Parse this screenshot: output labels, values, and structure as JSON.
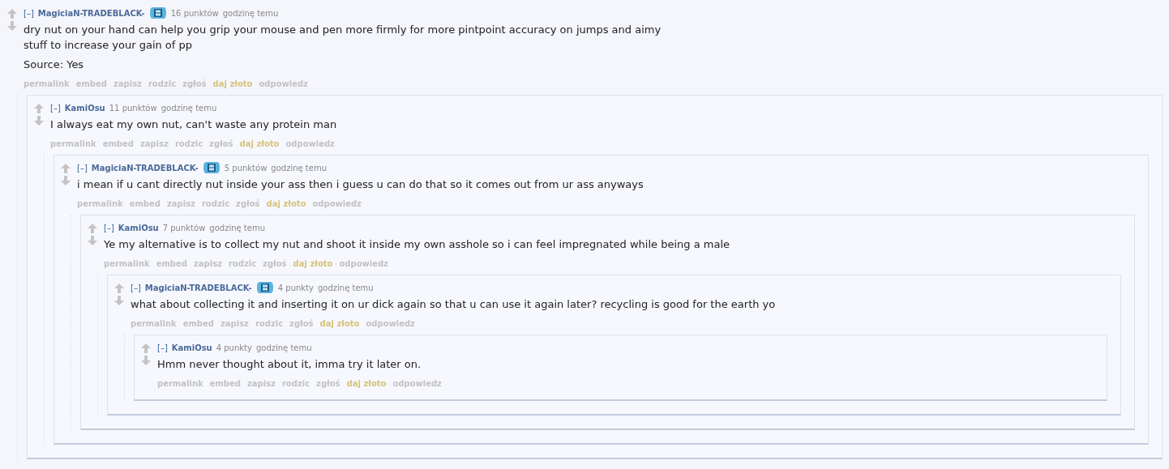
{
  "comments": [
    {
      "collapse": "[–]",
      "author": "MagiciaN-TRADEBLACK-",
      "flair": true,
      "score": "16 punktów",
      "time": "godzinę temu",
      "body": [
        "dry nut on your hand can help you grip your mouse and pen more firmly for more pintpoint accuracy on jumps and aimy stuff to increase your gain of pp",
        "Source: Yes"
      ],
      "buttons": [
        {
          "label": "permalink",
          "kind": "normal"
        },
        {
          "label": "embed",
          "kind": "normal"
        },
        {
          "label": "zapisz",
          "kind": "normal"
        },
        {
          "label": "rodzic",
          "kind": "normal"
        },
        {
          "label": "zgłoś",
          "kind": "normal"
        },
        {
          "label": "daj złoto",
          "kind": "gold"
        },
        {
          "label": "odpowiedz",
          "kind": "normal"
        }
      ],
      "children": [
        {
          "collapse": "[–]",
          "author": "KamiOsu",
          "flair": false,
          "score": "11 punktów",
          "time": "godzinę temu",
          "body": [
            "I always eat my own nut, can't waste any protein man"
          ],
          "buttons": [
            {
              "label": "permalink",
              "kind": "normal"
            },
            {
              "label": "embed",
              "kind": "normal"
            },
            {
              "label": "zapisz",
              "kind": "normal"
            },
            {
              "label": "rodzic",
              "kind": "normal"
            },
            {
              "label": "zgłoś",
              "kind": "normal"
            },
            {
              "label": "daj złoto",
              "kind": "gold"
            },
            {
              "label": "odpowiedz",
              "kind": "normal"
            }
          ],
          "children": [
            {
              "collapse": "[–]",
              "author": "MagiciaN-TRADEBLACK-",
              "flair": true,
              "score": "5 punktów",
              "time": "godzinę temu",
              "body": [
                "i mean if u cant directly nut inside your ass then i guess u can do that so it comes out from ur ass anyways"
              ],
              "buttons": [
                {
                  "label": "permalink",
                  "kind": "normal"
                },
                {
                  "label": "embed",
                  "kind": "normal"
                },
                {
                  "label": "zapisz",
                  "kind": "normal"
                },
                {
                  "label": "rodzic",
                  "kind": "normal"
                },
                {
                  "label": "zgłoś",
                  "kind": "normal"
                },
                {
                  "label": "daj złoto",
                  "kind": "gold"
                },
                {
                  "label": "odpowiedz",
                  "kind": "normal"
                }
              ],
              "children": [
                {
                  "collapse": "[–]",
                  "author": "KamiOsu",
                  "flair": false,
                  "score": "7 punktów",
                  "time": "godzinę temu",
                  "body": [
                    "Ye my alternative is to collect my nut and shoot it inside my own asshole so i can feel impregnated while being a male"
                  ],
                  "buttons": [
                    {
                      "label": "permalink",
                      "kind": "normal"
                    },
                    {
                      "label": "embed",
                      "kind": "normal"
                    },
                    {
                      "label": "zapisz",
                      "kind": "normal"
                    },
                    {
                      "label": "rodzic",
                      "kind": "normal"
                    },
                    {
                      "label": "zgłoś",
                      "kind": "normal"
                    },
                    {
                      "label": "daj złoto",
                      "kind": "gold"
                    },
                    {
                      "label": "odpowiedz",
                      "kind": "normal"
                    }
                  ],
                  "children": [
                    {
                      "collapse": "[–]",
                      "author": "MagiciaN-TRADEBLACK-",
                      "flair": true,
                      "score": "4 punkty",
                      "time": "godzinę temu",
                      "body": [
                        "what about collecting it and inserting it on ur dick again so that u can use it again later? recycling is good for the earth yo"
                      ],
                      "buttons": [
                        {
                          "label": "permalink",
                          "kind": "normal"
                        },
                        {
                          "label": "embed",
                          "kind": "normal"
                        },
                        {
                          "label": "zapisz",
                          "kind": "normal"
                        },
                        {
                          "label": "rodzic",
                          "kind": "normal"
                        },
                        {
                          "label": "zgłoś",
                          "kind": "normal"
                        },
                        {
                          "label": "daj złoto",
                          "kind": "gold"
                        },
                        {
                          "label": "odpowiedz",
                          "kind": "normal"
                        }
                      ],
                      "children": [
                        {
                          "collapse": "[–]",
                          "author": "KamiOsu",
                          "flair": false,
                          "score": "4 punkty",
                          "time": "godzinę temu",
                          "body": [
                            "Hmm never thought about it, imma try it later on."
                          ],
                          "buttons": [
                            {
                              "label": "permalink",
                              "kind": "normal"
                            },
                            {
                              "label": "embed",
                              "kind": "normal"
                            },
                            {
                              "label": "zapisz",
                              "kind": "normal"
                            },
                            {
                              "label": "rodzic",
                              "kind": "normal"
                            },
                            {
                              "label": "zgłoś",
                              "kind": "normal"
                            },
                            {
                              "label": "daj złoto",
                              "kind": "gold"
                            },
                            {
                              "label": "odpowiedz",
                              "kind": "normal"
                            }
                          ]
                        }
                      ]
                    }
                  ]
                }
              ]
            }
          ]
        }
      ]
    }
  ]
}
